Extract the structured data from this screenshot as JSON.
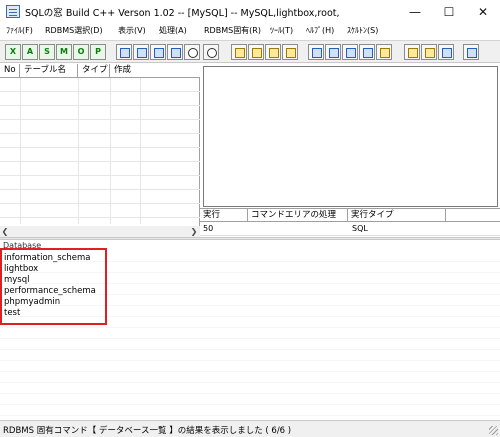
{
  "window": {
    "title": "SQLの窓 Build C++ Verson 1.02 -- [MySQL] -- MySQL,lightbox,root,"
  },
  "menu": {
    "items": [
      "ﾌｧｲﾙ(F)",
      "RDBMS選択(D)",
      "表示(V)",
      "処理(A)",
      "RDBMS固有(R)",
      "ﾂｰﾙ(T)",
      "ﾍﾙﾌﾟ(H)",
      "ｽｹﾙﾄﾝ(S)"
    ]
  },
  "toolbar": {
    "letter_buttons": [
      "X",
      "A",
      "S",
      "M",
      "O",
      "P"
    ],
    "icon_buttons": [
      "db-tree-icon",
      "expand-icon",
      "collapse-icon",
      "expand-all-icon",
      "refresh-icon",
      "search-icon",
      "col-icon",
      "col-prev-icon",
      "col-delete-icon",
      "col-next-icon",
      "window-icon",
      "chart-icon",
      "copy-icon",
      "save-icon",
      "open-folder-icon",
      "txt-export-icon",
      "filter-icon",
      "windows-icon",
      "font-icon"
    ],
    "icon_labels": {
      "col": "Col",
      "txt": "Txt"
    }
  },
  "table_grid": {
    "columns": [
      "No",
      "テーブル名",
      "タイプ",
      "作成"
    ]
  },
  "exec_panel": {
    "columns": [
      "実行",
      "コマンドエリアの処理",
      "実行タイプ"
    ],
    "rows": [
      {
        "exec": "50",
        "command": "",
        "type": "SQL"
      }
    ]
  },
  "results": {
    "section_label": "Database",
    "databases": [
      "information_schema",
      "lightbox",
      "mysql",
      "performance_schema",
      "phpmyadmin",
      "test"
    ]
  },
  "status": {
    "text": "RDBMS 固有コマンド【 データベース一覧 】の結果を表示しました ( 6/6 )"
  },
  "colors": {
    "highlight_box": "#e02020",
    "toolbar_letter": "#0b7d0b"
  }
}
